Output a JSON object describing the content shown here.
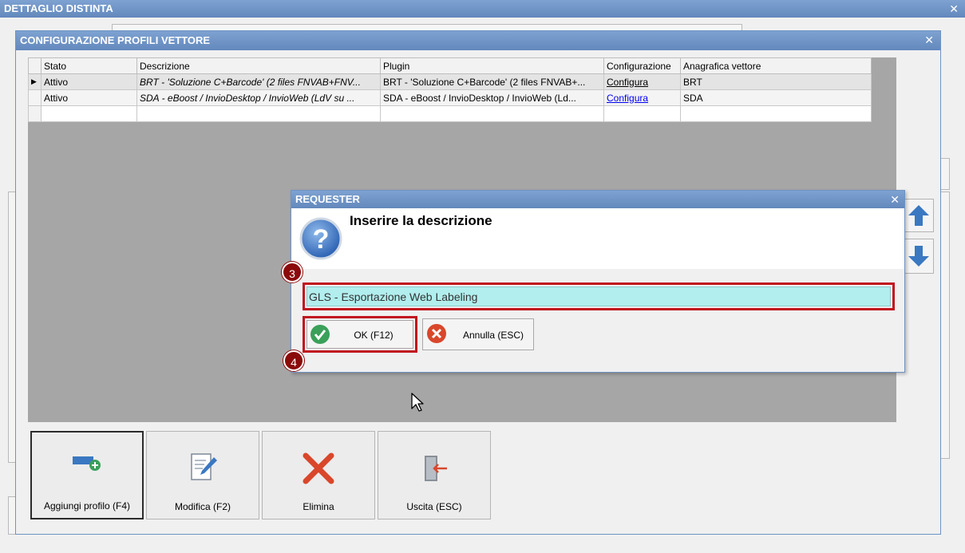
{
  "outer_window": {
    "title": "DETTAGLIO DISTINTA"
  },
  "profiles_window": {
    "title": "CONFIGURAZIONE PROFILI VETTORE"
  },
  "grid": {
    "headers": [
      "Stato",
      "Descrizione",
      "Plugin",
      "Configurazione",
      "Anagrafica vettore"
    ],
    "rows": [
      {
        "stato": "Attivo",
        "descrizione": "BRT - 'Soluzione C+Barcode' (2 files FNVAB+FNV...",
        "plugin": "BRT - 'Soluzione C+Barcode' (2 files FNVAB+...",
        "config": "Configura",
        "vettore": "BRT"
      },
      {
        "stato": "Attivo",
        "descrizione": "SDA - eBoost / InvioDesktop / InvioWeb (LdV su ...",
        "plugin": "SDA - eBoost / InvioDesktop / InvioWeb (Ld...",
        "config": "Configura",
        "vettore": "SDA"
      }
    ]
  },
  "requester": {
    "title": "REQUESTER",
    "message": "Inserire la descrizione",
    "input_value": "GLS - Esportazione Web Labeling",
    "ok_label": "OK (F12)",
    "cancel_label": "Annulla (ESC)"
  },
  "annotations": {
    "step_input": "3",
    "step_ok": "4"
  },
  "toolbar": {
    "add_label": "Aggiungi profilo (F4)",
    "edit_label": "Modifica (F2)",
    "delete_label": "Elimina",
    "exit_label": "Uscita (ESC)"
  },
  "colors": {
    "titlebar": "#6e93c4",
    "input_bg": "#b2eeee",
    "annotation": "#c0141e",
    "badge": "#8b0a0a",
    "arrow": "#3a78c2",
    "delete_x": "#d9472b"
  }
}
